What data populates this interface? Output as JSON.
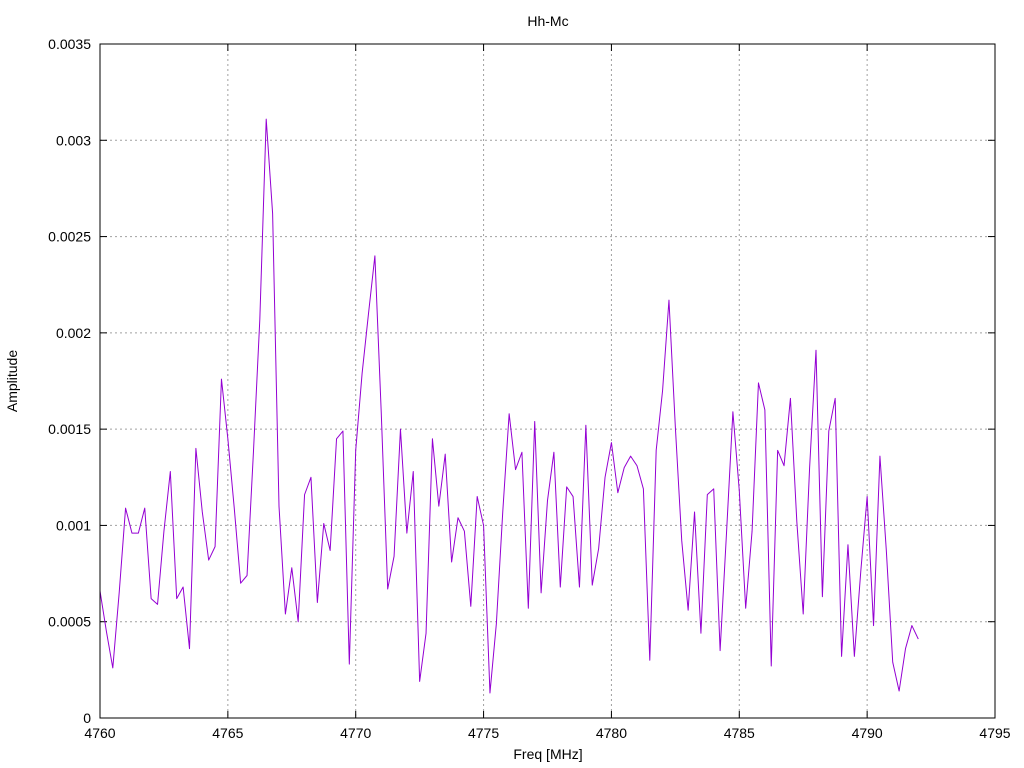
{
  "chart_data": {
    "type": "line",
    "title": "Hh-Mc",
    "xlabel": "Freq [MHz]",
    "ylabel": "Amplitude",
    "xlim": [
      4760,
      4795
    ],
    "ylim": [
      0,
      0.0035
    ],
    "xticks": [
      4760,
      4765,
      4770,
      4775,
      4780,
      4785,
      4790,
      4795
    ],
    "yticks": [
      0,
      0.0005,
      0.001,
      0.0015,
      0.002,
      0.0025,
      0.003,
      0.0035
    ],
    "xtick_labels": [
      "4760",
      "4765",
      "4770",
      "4775",
      "4780",
      "4785",
      "4790",
      "4795"
    ],
    "ytick_labels": [
      "0",
      "0.0005",
      "0.001",
      "0.0015",
      "0.002",
      "0.0025",
      "0.003",
      "0.0035"
    ],
    "grid": true,
    "series": [
      {
        "color": "#9400d3",
        "x": [
          4760.0,
          4760.25,
          4760.5,
          4760.75,
          4761.0,
          4761.25,
          4761.5,
          4761.75,
          4762.0,
          4762.25,
          4762.5,
          4762.75,
          4763.0,
          4763.25,
          4763.5,
          4763.75,
          4764.0,
          4764.25,
          4764.5,
          4764.75,
          4765.0,
          4765.25,
          4765.5,
          4765.75,
          4766.0,
          4766.25,
          4766.5,
          4766.75,
          4767.0,
          4767.25,
          4767.5,
          4767.75,
          4768.0,
          4768.25,
          4768.5,
          4768.75,
          4769.0,
          4769.25,
          4769.5,
          4769.75,
          4770.0,
          4770.25,
          4770.5,
          4770.75,
          4771.0,
          4771.25,
          4771.5,
          4771.75,
          4772.0,
          4772.25,
          4772.5,
          4772.75,
          4773.0,
          4773.25,
          4773.5,
          4773.75,
          4774.0,
          4774.25,
          4774.5,
          4774.75,
          4775.0,
          4775.25,
          4775.5,
          4775.75,
          4776.0,
          4776.25,
          4776.5,
          4776.75,
          4777.0,
          4777.25,
          4777.5,
          4777.75,
          4778.0,
          4778.25,
          4778.5,
          4778.75,
          4779.0,
          4779.25,
          4779.5,
          4779.75,
          4780.0,
          4780.25,
          4780.5,
          4780.75,
          4781.0,
          4781.25,
          4781.5,
          4781.75,
          4782.0,
          4782.25,
          4782.5,
          4782.75,
          4783.0,
          4783.25,
          4783.5,
          4783.75,
          4784.0,
          4784.25,
          4784.5,
          4784.75,
          4785.0,
          4785.25,
          4785.5,
          4785.75,
          4786.0,
          4786.25,
          4786.5,
          4786.75,
          4787.0,
          4787.25,
          4787.5,
          4787.75,
          4788.0,
          4788.25,
          4788.5,
          4788.75,
          4789.0,
          4789.25,
          4789.5,
          4789.75,
          4790.0,
          4790.25,
          4790.5,
          4790.75,
          4791.0,
          4791.25,
          4791.5,
          4791.75,
          4792.0
        ],
        "values": [
          0.00066,
          0.00045,
          0.00026,
          0.00065,
          0.00109,
          0.00096,
          0.00096,
          0.00109,
          0.00062,
          0.00059,
          0.00097,
          0.00128,
          0.00062,
          0.00068,
          0.00036,
          0.0014,
          0.00107,
          0.00082,
          0.00089,
          0.00176,
          0.00145,
          0.00109,
          0.0007,
          0.00074,
          0.00138,
          0.00207,
          0.00311,
          0.00262,
          0.0011,
          0.00054,
          0.00078,
          0.0005,
          0.00116,
          0.00125,
          0.0006,
          0.00101,
          0.00087,
          0.00145,
          0.00149,
          0.00028,
          0.00139,
          0.00179,
          0.0021,
          0.0024,
          0.00158,
          0.00067,
          0.00084,
          0.0015,
          0.00096,
          0.00128,
          0.00019,
          0.00044,
          0.00145,
          0.0011,
          0.00137,
          0.00081,
          0.00104,
          0.00097,
          0.00058,
          0.00115,
          0.001,
          0.00013,
          0.00049,
          0.00107,
          0.00158,
          0.00129,
          0.00138,
          0.00057,
          0.00154,
          0.00065,
          0.00113,
          0.00138,
          0.00068,
          0.0012,
          0.00115,
          0.00068,
          0.00152,
          0.00069,
          0.00088,
          0.00125,
          0.00143,
          0.00117,
          0.0013,
          0.00136,
          0.00131,
          0.00119,
          0.0003,
          0.00139,
          0.0017,
          0.00217,
          0.00151,
          0.00092,
          0.00056,
          0.00107,
          0.00044,
          0.00116,
          0.00119,
          0.00035,
          0.00096,
          0.00159,
          0.00118,
          0.00057,
          0.00097,
          0.00174,
          0.0016,
          0.00027,
          0.00139,
          0.00131,
          0.00166,
          0.00102,
          0.00054,
          0.0013,
          0.00191,
          0.00063,
          0.00149,
          0.00166,
          0.00032,
          0.0009,
          0.00032,
          0.00076,
          0.00115,
          0.00048,
          0.00136,
          0.00087,
          0.00029,
          0.00014,
          0.00036,
          0.00048,
          0.00041
        ]
      }
    ]
  }
}
